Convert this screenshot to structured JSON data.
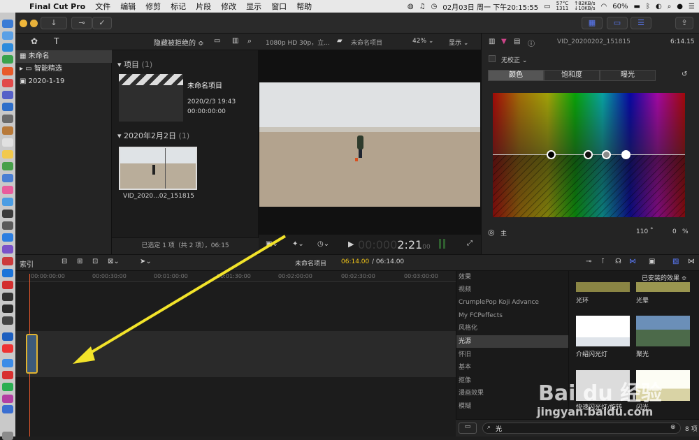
{
  "menubar": {
    "app_name": "Final Cut Pro",
    "menus": [
      "文件",
      "编辑",
      "修剪",
      "标记",
      "片段",
      "修改",
      "显示",
      "窗口",
      "帮助"
    ],
    "clock": "02月03日 周一 下午20:15:55",
    "battery": "60%",
    "temp_line1": "57°C",
    "temp_line2": "1311",
    "net_up": "↑82KB/s",
    "net_down": "↓10KB/s"
  },
  "library_panel": {
    "hide_rejected": "隐藏被拒绝的 ≎",
    "items": [
      {
        "label": "未命名",
        "selected": true
      },
      {
        "label": "智能精选",
        "selected": false
      },
      {
        "label": "2020-1-19",
        "selected": false
      }
    ]
  },
  "browser": {
    "section_project_title": "项目",
    "section_project_count": "(1)",
    "project": {
      "name": "未命名项目",
      "date": "2020/2/3 19:43",
      "duration": "00:00:00:00"
    },
    "section_date_title": "2020年2月2日",
    "section_date_count": "(1)",
    "clip_name": "VID_2020...02_151815",
    "status": "已选定 1 项（共 2 项），06:15"
  },
  "viewer": {
    "format": "1080p HD 30p，立...",
    "project_name": "未命名项目",
    "zoom": "42% ⌄",
    "display": "显示 ⌄",
    "timecode": "00:00:02:21",
    "timecode_dim": "00:000",
    "timecode_bright": "2:21",
    "timecode_sub": "00"
  },
  "inspector": {
    "title": "VID_20200202_151815",
    "duration": "6:14.15",
    "correction": "无校正 ⌄",
    "tabs": [
      {
        "label": "颜色",
        "selected": true
      },
      {
        "label": "饱和度",
        "selected": false
      },
      {
        "label": "曝光",
        "selected": false
      }
    ],
    "bottom_label": "主",
    "hue_value": "110",
    "hue_unit": "°",
    "percent_value": "0",
    "percent_unit": "%"
  },
  "timeline": {
    "index_label": "索引",
    "project_name": "未命名项目",
    "position": "06:14.00",
    "total": "/ 06:14.00",
    "ruler": [
      "00:00:00:00",
      "00:00:30:00",
      "00:01:00:00",
      "00:01:30:00",
      "00:02:00:00",
      "00:02:30:00",
      "00:03:00:00"
    ]
  },
  "effects": {
    "header": "效果",
    "installed": "已安装的效果 ≎",
    "categories": [
      {
        "label": "视频",
        "selected": false
      },
      {
        "label": "CrumplePop Koji Advance",
        "selected": false
      },
      {
        "label": "My FCPeffects",
        "selected": false
      },
      {
        "label": "风格化",
        "selected": false
      },
      {
        "label": "光源",
        "selected": true
      },
      {
        "label": "怀旧",
        "selected": false
      },
      {
        "label": "基本",
        "selected": false
      },
      {
        "label": "抠像",
        "selected": false
      },
      {
        "label": "漫画效果",
        "selected": false
      },
      {
        "label": "模糊",
        "selected": false
      }
    ],
    "thumbs": [
      "光环",
      "光晕",
      "介绍闪光灯",
      "聚光",
      "快速闪光灯/旋转",
      "闪光"
    ],
    "search_text": "光",
    "count": "8 项"
  },
  "watermark": {
    "brand": "Bai du 经验",
    "url": "jingyan.baidu.com"
  },
  "colors": {
    "accent_blue": "#5b7cff",
    "playhead": "#e2572a",
    "clip_border": "#e0b331",
    "arrow": "#f2e32a",
    "timecode_yellow": "#f0c419"
  }
}
